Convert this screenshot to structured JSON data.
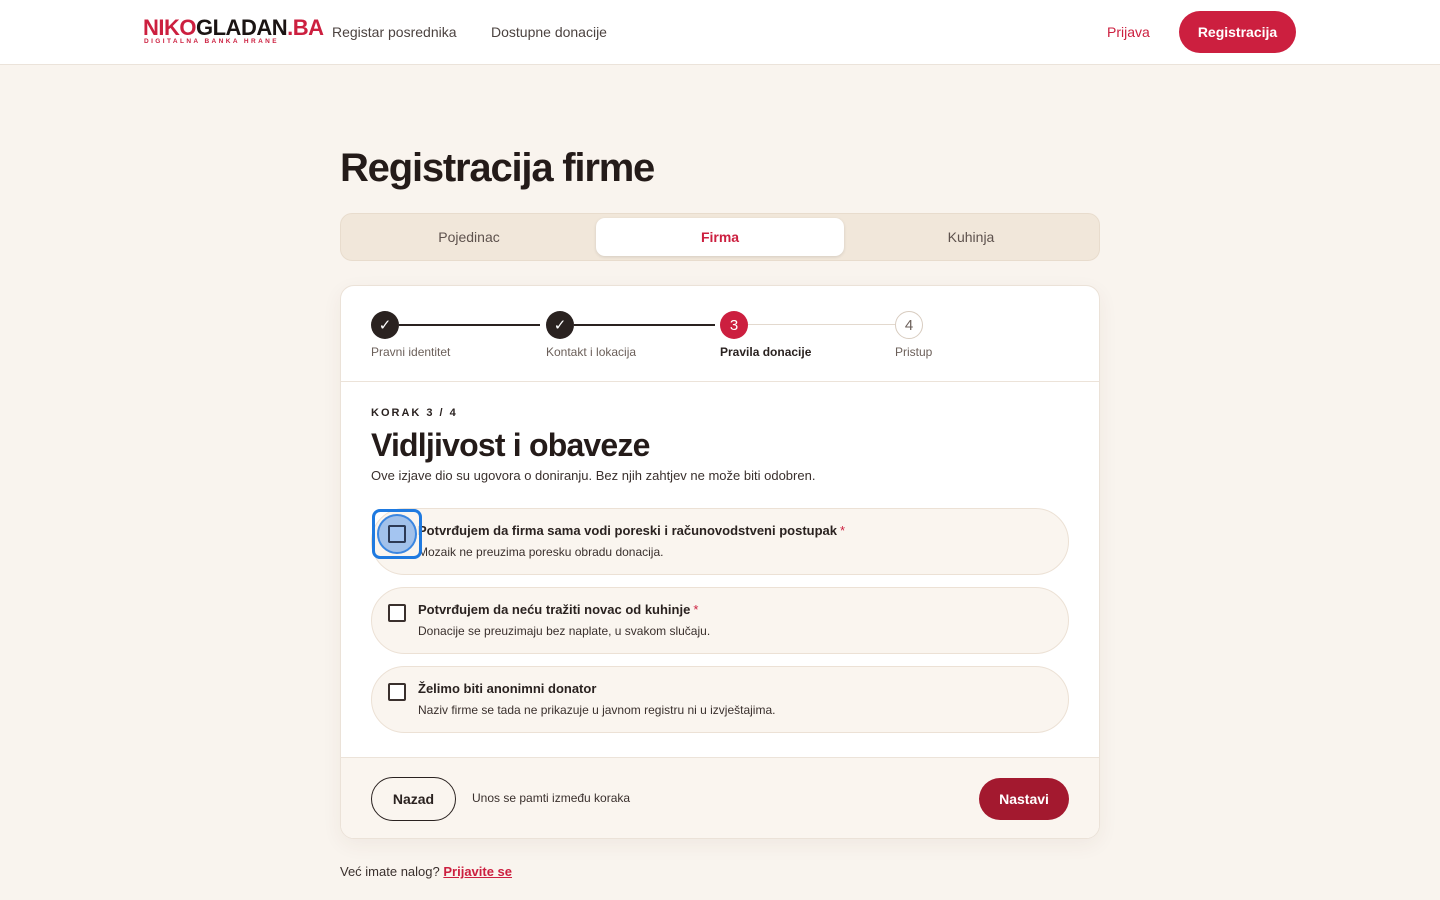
{
  "header": {
    "logo_main_red": "NIKO",
    "logo_main_dark": "GLADAN",
    "logo_main_tld": ".BA",
    "logo_sub": "DIGITALNA BANKA HRANE",
    "nav": [
      "Registar posrednika",
      "Dostupne donacije"
    ],
    "login_label": "Prijava",
    "register_label": "Registracija"
  },
  "page": {
    "title": "Registracija firme"
  },
  "tabs": [
    {
      "label": "Pojedinac",
      "active": false
    },
    {
      "label": "Firma",
      "active": true
    },
    {
      "label": "Kuhinja",
      "active": false
    }
  ],
  "stepper": {
    "steps": [
      {
        "label": "Pravni identitet",
        "status": "done",
        "marker": "✓"
      },
      {
        "label": "Kontakt i lokacija",
        "status": "done",
        "marker": "✓"
      },
      {
        "label": "Pravila donacije",
        "status": "current",
        "marker": "3"
      },
      {
        "label": "Pristup",
        "status": "todo",
        "marker": "4"
      }
    ]
  },
  "form": {
    "eyebrow": "KORAK 3 / 4",
    "title": "Vidljivost i obaveze",
    "description": "Ove izjave dio su ugovora o doniranju. Bez njih zahtjev ne može biti odobren.",
    "options": [
      {
        "title": "Potvrđujem da firma sama vodi poreski i računovodstveni postupak",
        "required_mark": "*",
        "subtitle": "Mozaik ne preuzima poresku obradu donacija.",
        "checked": false
      },
      {
        "title": "Potvrđujem da neću tražiti novac od kuhinje",
        "required_mark": "*",
        "subtitle": "Donacije se preuzimaju bez naplate, u svakom slučaju.",
        "checked": false
      },
      {
        "title": "Želimo biti anonimni donator",
        "required_mark": "",
        "subtitle": "Naziv firme se tada ne prikazuje u javnom registru ni u izvještajima.",
        "checked": false
      }
    ]
  },
  "footer": {
    "back_label": "Nazad",
    "hint": "Unos se pamti između koraka",
    "next_label": "Nastavi"
  },
  "bottom": {
    "text": "Već imate nalog?",
    "link": "Prijavite se"
  },
  "colors": {
    "accent": "#cc1f3f",
    "accent_dark": "#a3192f",
    "background": "#f9f4ee",
    "focus": "#1f7ae0"
  }
}
